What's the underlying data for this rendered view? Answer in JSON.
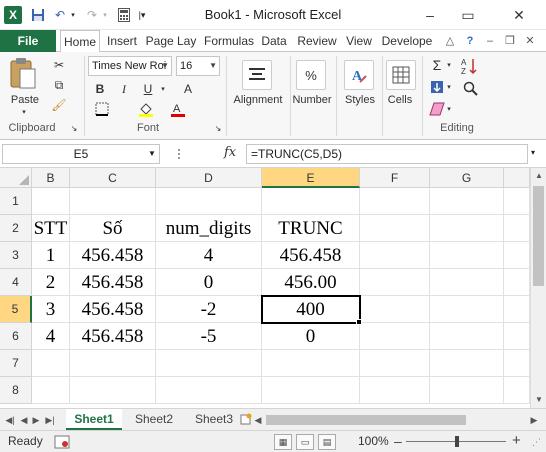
{
  "window": {
    "title": "Book1 - Microsoft Excel"
  },
  "quick_access": {
    "app_icon": "excel-icon",
    "save_icon": "save-icon",
    "undo_icon": "undo-icon",
    "redo_icon": "redo-icon",
    "calc_icon": "calculator-icon"
  },
  "window_controls": {
    "minimize": "–",
    "restore": "▭",
    "close": "✕"
  },
  "tabs": [
    "File",
    "Home",
    "Insert",
    "Page Lay",
    "Formulas",
    "Data",
    "Review",
    "View",
    "Develope"
  ],
  "ribbon": {
    "clipboard": {
      "paste": "Paste",
      "label": "Clipboard"
    },
    "font": {
      "name": "Times New Roi",
      "size": "16",
      "bold": "B",
      "italic": "I",
      "underline": "U",
      "grow": "A",
      "label": "Font"
    },
    "alignment": {
      "label": "Alignment"
    },
    "number": {
      "label": "Number",
      "icon": "%"
    },
    "styles": {
      "label": "Styles"
    },
    "cells": {
      "label": "Cells"
    },
    "editing": {
      "label": "Editing",
      "sum": "Σ"
    }
  },
  "formula_bar": {
    "name_box": "E5",
    "fx": "fx",
    "formula": "=TRUNC(C5,D5)"
  },
  "grid": {
    "columns": [
      "B",
      "C",
      "D",
      "E",
      "F",
      "G"
    ],
    "selected_column": "E",
    "rows": [
      "1",
      "2",
      "3",
      "4",
      "5",
      "6",
      "7",
      "8"
    ],
    "selected_row": "5",
    "cells": [
      [
        "",
        "",
        "",
        "",
        "",
        ""
      ],
      [
        "STT",
        "Số",
        "num_digits",
        "TRUNC",
        "",
        ""
      ],
      [
        "1",
        "456.458",
        "4",
        "456.458",
        "",
        ""
      ],
      [
        "2",
        "456.458",
        "0",
        "456.00",
        "",
        ""
      ],
      [
        "3",
        "456.458",
        "-2",
        "400",
        "",
        ""
      ],
      [
        "4",
        "456.458",
        "-5",
        "0",
        "",
        ""
      ],
      [
        "",
        "",
        "",
        "",
        "",
        ""
      ],
      [
        "",
        "",
        "",
        "",
        "",
        ""
      ]
    ]
  },
  "sheets": {
    "tabs": [
      "Sheet1",
      "Sheet2",
      "Sheet3"
    ],
    "active": "Sheet1"
  },
  "status": {
    "ready": "Ready",
    "zoom": "100%",
    "zoom_out": "–",
    "zoom_in": "+"
  }
}
